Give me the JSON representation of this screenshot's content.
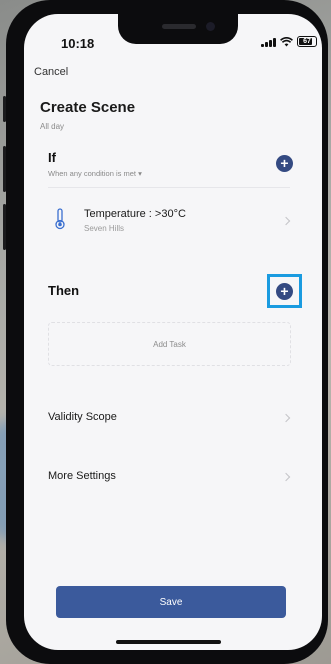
{
  "status_bar": {
    "time": "10:18",
    "battery": "67"
  },
  "header": {
    "cancel": "Cancel",
    "title": "Create Scene",
    "subtitle": "All day"
  },
  "if_section": {
    "label": "If",
    "condition_mode": "When any condition is met",
    "dropdown_indicator": "▾",
    "conditions": [
      {
        "title": "Temperature : >30°C",
        "location": "Seven Hills",
        "icon": "thermometer-icon"
      }
    ]
  },
  "then_section": {
    "label": "Then",
    "add_task": "Add Task"
  },
  "settings": {
    "validity_scope": "Validity Scope",
    "more_settings": "More Settings"
  },
  "save_label": "Save",
  "colors": {
    "accent": "#344a82",
    "save_button": "#3b5a9c",
    "highlight": "#1a9be0"
  }
}
